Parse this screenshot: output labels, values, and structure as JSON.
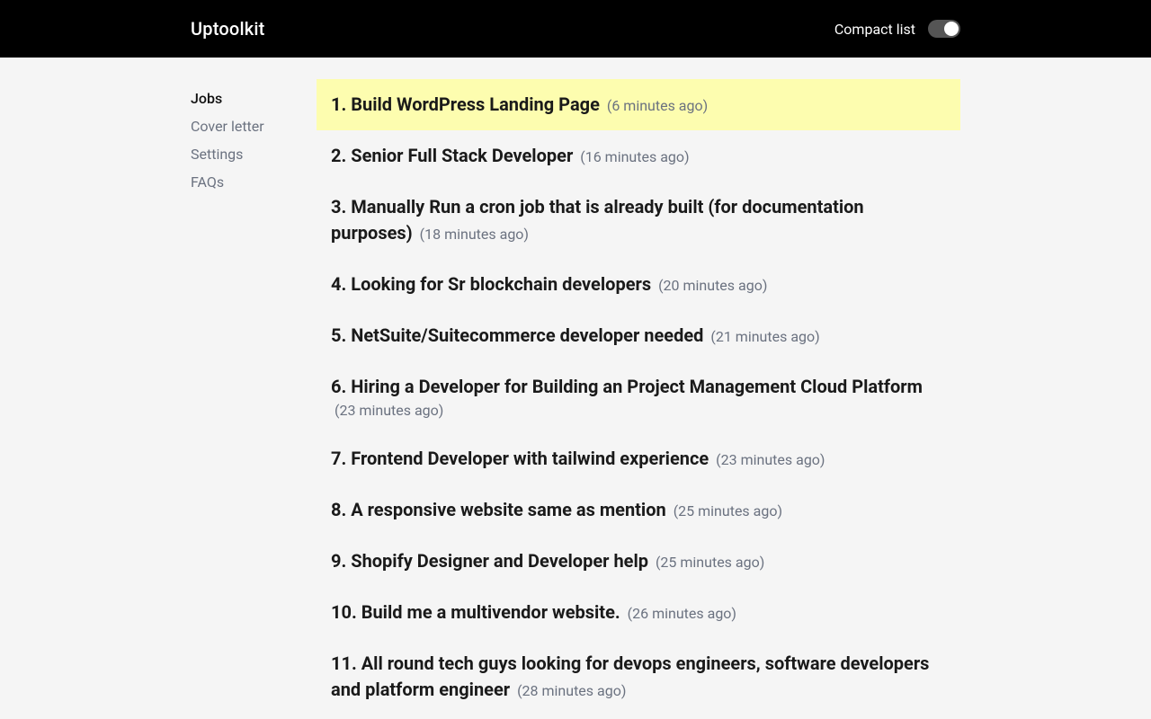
{
  "header": {
    "brand": "Uptoolkit",
    "compact_label": "Compact list",
    "compact_enabled": true
  },
  "sidebar": {
    "items": [
      {
        "label": "Jobs",
        "active": true
      },
      {
        "label": "Cover letter",
        "active": false
      },
      {
        "label": "Settings",
        "active": false
      },
      {
        "label": "FAQs",
        "active": false
      }
    ]
  },
  "jobs": [
    {
      "index": "1.",
      "title": "Build WordPress Landing Page",
      "time": "(6 minutes ago)",
      "highlighted": true
    },
    {
      "index": "2.",
      "title": "Senior Full Stack Developer",
      "time": "(16 minutes ago)",
      "highlighted": false
    },
    {
      "index": "3.",
      "title": "Manually Run a cron job that is already built (for documentation purposes)",
      "time": "(18 minutes ago)",
      "highlighted": false
    },
    {
      "index": "4.",
      "title": "Looking for Sr blockchain developers",
      "time": "(20 minutes ago)",
      "highlighted": false
    },
    {
      "index": "5.",
      "title": "NetSuite/Suitecommerce developer needed",
      "time": "(21 minutes ago)",
      "highlighted": false
    },
    {
      "index": "6.",
      "title": "Hiring a Developer for Building an Project Management Cloud Platform",
      "time": "(23 minutes ago)",
      "highlighted": false
    },
    {
      "index": "7.",
      "title": "Frontend Developer with tailwind experience",
      "time": "(23 minutes ago)",
      "highlighted": false
    },
    {
      "index": "8.",
      "title": "A responsive website same as mention",
      "time": "(25 minutes ago)",
      "highlighted": false
    },
    {
      "index": "9.",
      "title": "Shopify Designer and Developer help",
      "time": "(25 minutes ago)",
      "highlighted": false
    },
    {
      "index": "10.",
      "title": "Build me a multivendor website.",
      "time": "(26 minutes ago)",
      "highlighted": false
    },
    {
      "index": "11.",
      "title": "All round tech guys looking for devops engineers, software developers and platform engineer",
      "time": "(28 minutes ago)",
      "highlighted": false
    }
  ]
}
